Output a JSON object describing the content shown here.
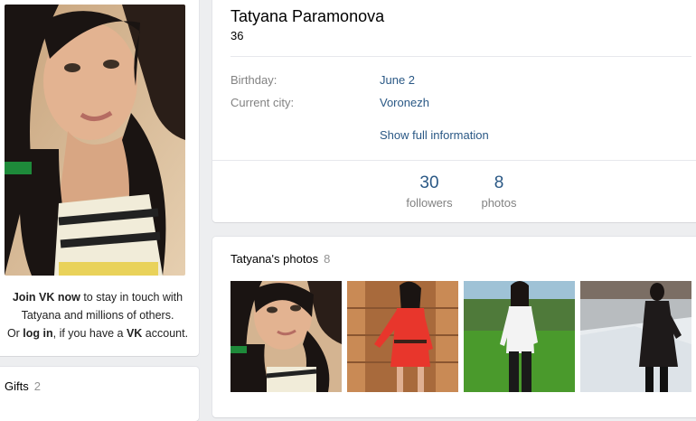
{
  "profile": {
    "name": "Tatyana Paramonova",
    "age": "36",
    "birthday_label": "Birthday:",
    "birthday_value": "June 2",
    "city_label": "Current city:",
    "city_value": "Voronezh",
    "show_full": "Show full information",
    "followers_count": "30",
    "followers_label": "followers",
    "photos_count": "8",
    "photos_label": "photos"
  },
  "join": {
    "join_now": "Join VK now",
    "text1": " to stay in touch with Tatyana and millions of others.",
    "or": "Or ",
    "log_in": "log in",
    "text2": ", if you have a ",
    "vk": "VK",
    "text3": " account."
  },
  "gifts": {
    "title": "Gifts",
    "count": "2"
  },
  "photos": {
    "title": "Tatyana's photos",
    "count": "8"
  },
  "colors": {
    "link": "#2a5885",
    "muted": "#828282",
    "background": "#edeef0"
  }
}
